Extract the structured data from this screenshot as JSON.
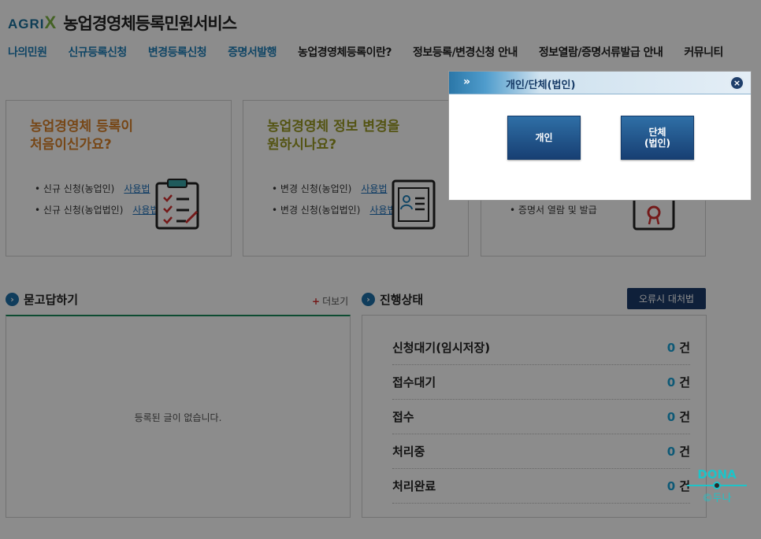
{
  "header": {
    "brand": "AGRI",
    "brand_x": "X",
    "site_title": "농업경영체등록민원서비스"
  },
  "nav": [
    {
      "label": "나의민원"
    },
    {
      "label": "신규등록신청"
    },
    {
      "label": "변경등록신청"
    },
    {
      "label": "증명서발행"
    },
    {
      "label": "농업경영체등록이란?"
    },
    {
      "label": "정보등록/변경신청 안내"
    },
    {
      "label": "정보열람/증명서류발급 안내"
    },
    {
      "label": "커뮤니티"
    }
  ],
  "cards": {
    "new": {
      "heading_1": "농업경영체 등록이",
      "heading_2": "처음이신가요?",
      "items": [
        {
          "text": "신규 신청(농업인)",
          "link": "사용법"
        },
        {
          "text": "신규 신청(농업법인)",
          "link": "사용법"
        }
      ],
      "icon": "clipboard-checklist-icon"
    },
    "change": {
      "heading_1": "농업경영체 정보 변경을",
      "heading_2": "원하시나요?",
      "items": [
        {
          "text": "변경 신청(농업인)",
          "link": "사용법"
        },
        {
          "text": "변경 신청(농업법인)",
          "link": "사용법"
        }
      ],
      "icon": "profile-card-icon"
    },
    "certificate": {
      "items": [
        {
          "text": "증명서 열람 및 발급"
        }
      ],
      "icon": "certificate-icon"
    }
  },
  "qa": {
    "title": "묻고답하기",
    "more": "더보기",
    "empty": "등록된 글이 없습니다."
  },
  "status": {
    "title": "진행상태",
    "error_button": "오류시 대처법",
    "unit": "건",
    "rows": [
      {
        "label": "신청대기(임시저장)",
        "count": "0"
      },
      {
        "label": "접수대기",
        "count": "0"
      },
      {
        "label": "접수",
        "count": "0"
      },
      {
        "label": "처리중",
        "count": "0"
      },
      {
        "label": "처리완료",
        "count": "0"
      }
    ]
  },
  "modal": {
    "chevron": "»",
    "title": "개인/단체(법인)",
    "close": "×",
    "individual_button": "개인",
    "group_button": "단체\n(법인)"
  },
  "watermark": {
    "title": "DONA",
    "sub": "©두나"
  },
  "colors": {
    "accent_blue": "#1e7fb8",
    "orange_heading": "#d9822b",
    "olive_heading": "#9a9a24",
    "count_blue": "#1aa3d8",
    "dark_navy": "#1c3b6a"
  }
}
